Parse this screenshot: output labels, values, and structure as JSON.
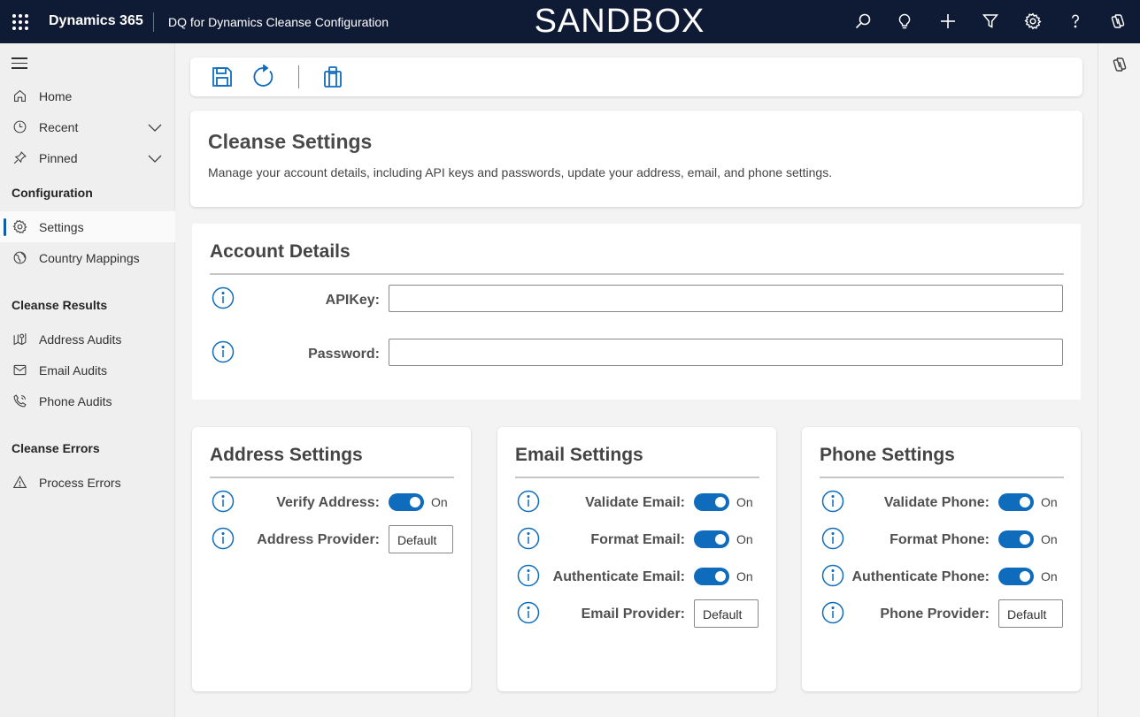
{
  "topbar": {
    "app_name": "Dynamics 365",
    "app_title": "DQ for Dynamics Cleanse Configuration",
    "environment_label": "SANDBOX",
    "icons": [
      "search-icon",
      "lightbulb-icon",
      "plus-icon",
      "filter-icon",
      "gear-icon",
      "help-icon",
      "copilot-icon"
    ]
  },
  "sidebar": {
    "items": [
      {
        "label": "Home",
        "icon": "home-icon"
      },
      {
        "label": "Recent",
        "icon": "clock-icon"
      },
      {
        "label": "Pinned",
        "icon": "pin-icon"
      }
    ],
    "sections": [
      {
        "title": "Configuration",
        "items": [
          {
            "label": "Settings",
            "icon": "gear-icon",
            "active": true
          },
          {
            "label": "Country Mappings",
            "icon": "globe-icon"
          }
        ]
      },
      {
        "title": "Cleanse Results",
        "items": [
          {
            "label": "Address Audits",
            "icon": "map-icon"
          },
          {
            "label": "Email Audits",
            "icon": "mail-icon"
          },
          {
            "label": "Phone Audits",
            "icon": "phone-icon"
          }
        ]
      },
      {
        "title": "Cleanse Errors",
        "items": [
          {
            "label": "Process Errors",
            "icon": "warning-icon"
          }
        ]
      }
    ]
  },
  "toolbar": {
    "buttons": [
      "save-icon",
      "refresh-icon",
      "clipboard-icon"
    ]
  },
  "cleanse": {
    "title": "Cleanse Settings",
    "description": "Manage your account details, including API keys and passwords, update your address, email, and phone settings."
  },
  "account": {
    "title": "Account Details",
    "apikey_label": "APIKey:",
    "apikey_value": "",
    "password_label": "Password:",
    "password_value": ""
  },
  "address": {
    "title": "Address Settings",
    "verify_label": "Verify Address:",
    "verify_state": "On",
    "provider_label": "Address Provider:",
    "provider_value": "Default"
  },
  "email": {
    "title": "Email Settings",
    "validate_label": "Validate Email:",
    "validate_state": "On",
    "format_label": "Format Email:",
    "format_state": "On",
    "authenticate_label": "Authenticate Email:",
    "authenticate_state": "On",
    "provider_label": "Email Provider:",
    "provider_value": "Default"
  },
  "phone": {
    "title": "Phone Settings",
    "validate_label": "Validate Phone:",
    "validate_state": "On",
    "format_label": "Format Phone:",
    "format_state": "On",
    "authenticate_label": "Authenticate Phone:",
    "authenticate_state": "On",
    "provider_label": "Phone Provider:",
    "provider_value": "Default"
  },
  "colors": {
    "topbar_bg": "#0f1b34",
    "accent": "#0f6cbd",
    "toggle_on": "#0f6cbd"
  }
}
